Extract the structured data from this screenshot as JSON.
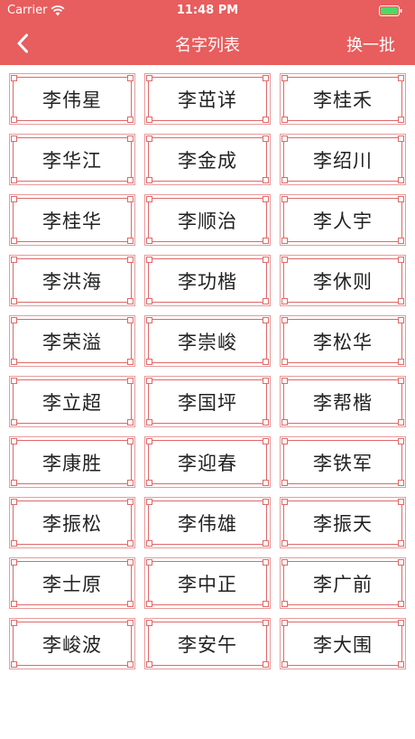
{
  "status_bar": {
    "carrier": "Carrier",
    "time": "11:48 PM",
    "wifi_icon": "wifi-icon",
    "battery_icon": "battery-icon",
    "battery_color": "#4cd964"
  },
  "nav": {
    "back_icon": "chevron-left-icon",
    "title": "名字列表",
    "refresh_label": "换一批"
  },
  "colors": {
    "header_bg": "#e85d5d",
    "card_border": "#e06868"
  },
  "names": [
    "李伟星",
    "李茁详",
    "李桂禾",
    "李华江",
    "李金成",
    "李绍川",
    "李桂华",
    "李顺治",
    "李人宇",
    "李洪海",
    "李功楷",
    "李休则",
    "李荣溢",
    "李崇峻",
    "李松华",
    "李立超",
    "李国坪",
    "李帮楷",
    "李康胜",
    "李迎春",
    "李铁军",
    "李振松",
    "李伟雄",
    "李振天",
    "李士原",
    "李中正",
    "李广前",
    "李峻波",
    "李安午",
    "李大围"
  ]
}
